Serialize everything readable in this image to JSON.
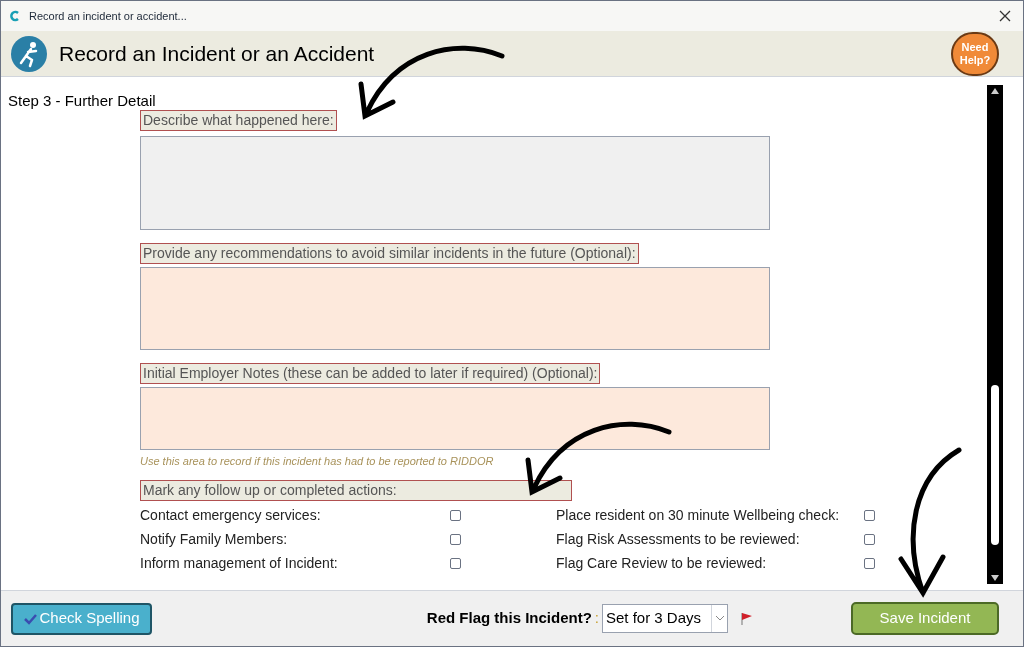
{
  "window": {
    "title": "Record an incident or accident..."
  },
  "header": {
    "title": "Record an Incident or an Accident",
    "help_button": "Need Help?"
  },
  "step_title": "Step 3 - Further Detail",
  "fields": [
    {
      "label": "Describe what happened here:",
      "color": "#f0f0f0"
    },
    {
      "label": "Provide any recommendations to avoid similar incidents in the future (Optional):",
      "color": "#fde9dc"
    },
    {
      "label": "Initial Employer Notes (these can be added to later if required) (Optional):",
      "color": "#fde9dc",
      "hint": "Use this area to record if this incident has had to be reported to RIDDOR"
    }
  ],
  "actions": {
    "label": "Mark any follow up or completed actions:",
    "left": [
      {
        "label": "Contact emergency services:",
        "checked": false
      },
      {
        "label": "Notify Family Members:",
        "checked": false
      },
      {
        "label": "Inform management of Incident:",
        "checked": false
      }
    ],
    "right": [
      {
        "label": "Place resident on 30 minute Wellbeing check:",
        "checked": false
      },
      {
        "label": "Flag Risk Assessments to be reviewed:",
        "checked": false
      },
      {
        "label": "Flag Care Review to be reviewed:",
        "checked": false
      }
    ]
  },
  "footer": {
    "spell_button": "Check Spelling",
    "red_flag_label": "Red Flag this Incident?",
    "red_flag_colon": ":",
    "red_flag_value": "Set for 3 Days",
    "save_button": "Save Incident"
  }
}
